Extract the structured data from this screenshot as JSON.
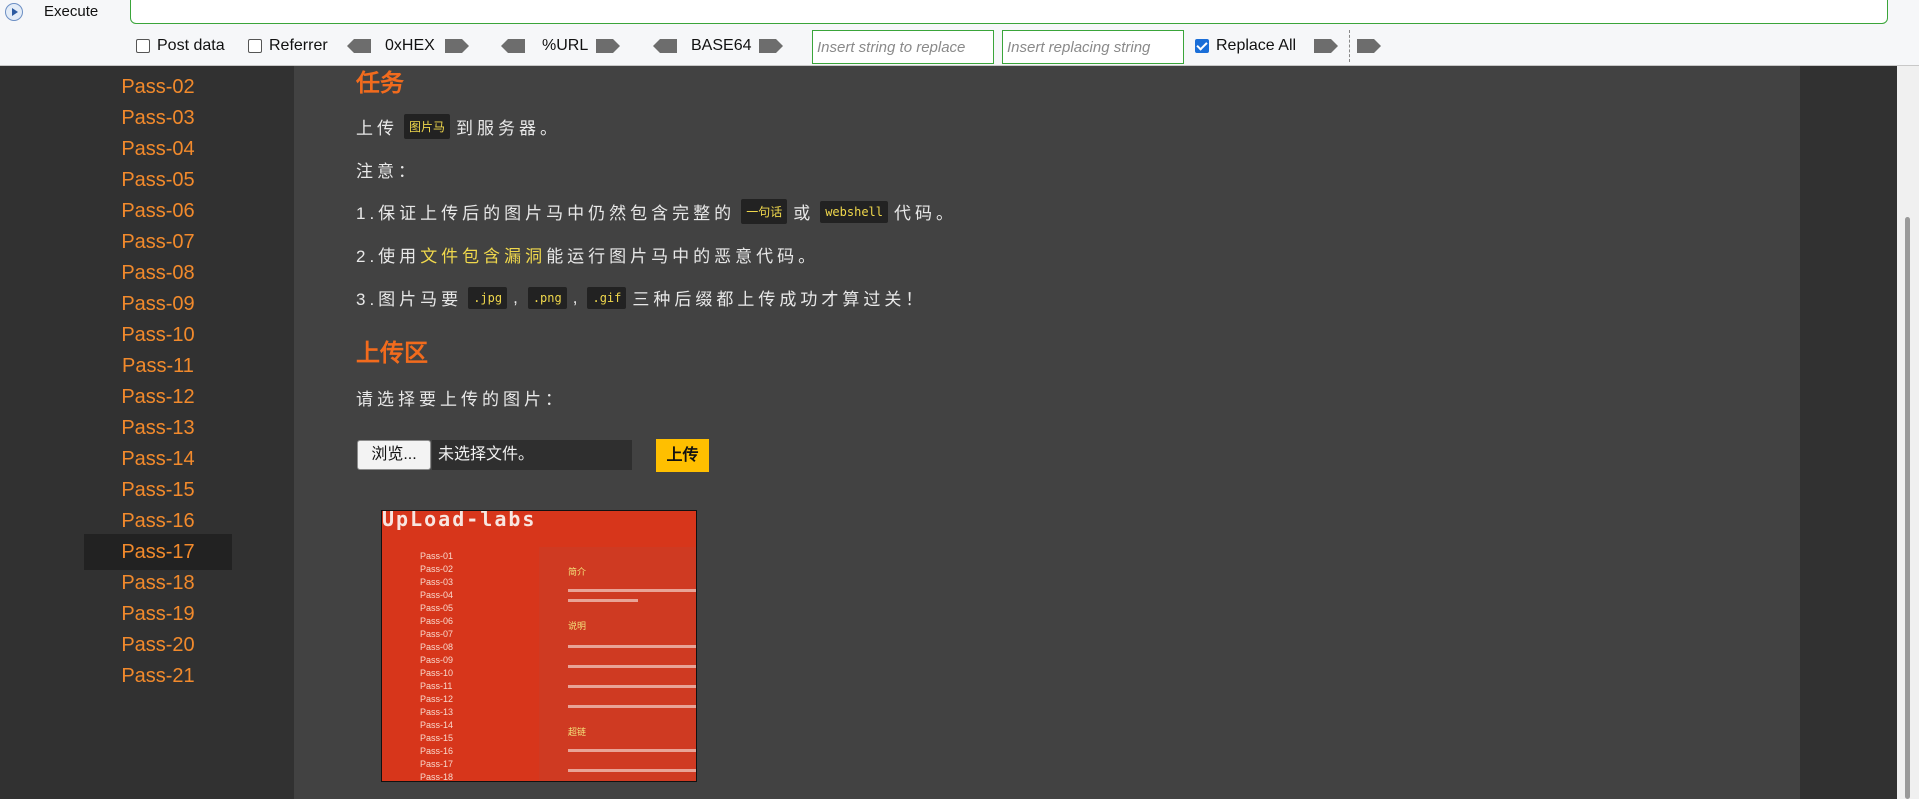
{
  "toolbar": {
    "execute_label": "Execute",
    "post_data_label": "Post data",
    "post_data_checked": false,
    "referrer_label": "Referrer",
    "referrer_checked": false,
    "hex_label": "0xHEX",
    "url_label": "%URL",
    "base64_label": "BASE64",
    "replace_placeholder": "Insert string to replace",
    "replacing_placeholder": "Insert replacing string",
    "replace_all_label": "Replace All",
    "replace_all_checked": true
  },
  "sidebar": {
    "items": [
      {
        "label": "Pass-02"
      },
      {
        "label": "Pass-03"
      },
      {
        "label": "Pass-04"
      },
      {
        "label": "Pass-05"
      },
      {
        "label": "Pass-06"
      },
      {
        "label": "Pass-07"
      },
      {
        "label": "Pass-08"
      },
      {
        "label": "Pass-09"
      },
      {
        "label": "Pass-10"
      },
      {
        "label": "Pass-11"
      },
      {
        "label": "Pass-12"
      },
      {
        "label": "Pass-13"
      },
      {
        "label": "Pass-14"
      },
      {
        "label": "Pass-15"
      },
      {
        "label": "Pass-16"
      },
      {
        "label": "Pass-17"
      },
      {
        "label": "Pass-18"
      },
      {
        "label": "Pass-19"
      },
      {
        "label": "Pass-20"
      },
      {
        "label": "Pass-21"
      }
    ],
    "active_label": "Pass-17"
  },
  "task": {
    "heading": "任务",
    "line1_a": "上传",
    "line1_code": "图片马",
    "line1_b": "到服务器。",
    "note": "注意：",
    "item1_a": "1.保证上传后的图片马中仍然包含完整的",
    "item1_code1": "一句话",
    "item1_b": "或",
    "item1_code2": "webshell",
    "item1_c": "代码。",
    "item2_a": "2.使用",
    "item2_link": "文件包含漏洞",
    "item2_b": "能运行图片马中的恶意代码。",
    "item3_a": "3.图片马要",
    "item3_code1": ".jpg",
    "item3_sep1": ",",
    "item3_code2": ".png",
    "item3_sep2": ",",
    "item3_code3": ".gif",
    "item3_b": "三种后缀都上传成功才算过关！"
  },
  "upload": {
    "heading": "上传区",
    "prompt": "请选择要上传的图片：",
    "browse_label": "浏览...",
    "file_status": "未选择文件。",
    "submit_label": "上传"
  },
  "thumbnail": {
    "title": "UpLoad-labs",
    "nav_items": [
      "Pass-01",
      "Pass-02",
      "Pass-03",
      "Pass-04",
      "Pass-05",
      "Pass-06",
      "Pass-07",
      "Pass-08",
      "Pass-09",
      "Pass-10",
      "Pass-11",
      "Pass-12",
      "Pass-13",
      "Pass-14",
      "Pass-15",
      "Pass-16",
      "Pass-17",
      "Pass-18"
    ],
    "panel_head1": "简介",
    "panel_head2": "说明",
    "panel_head3": "超链"
  },
  "colors": {
    "accent_orange": "#f26b1d",
    "nav_orange": "#f28a2c",
    "code_yellow": "#f0d84c",
    "button_yellow": "#ffbf00"
  }
}
